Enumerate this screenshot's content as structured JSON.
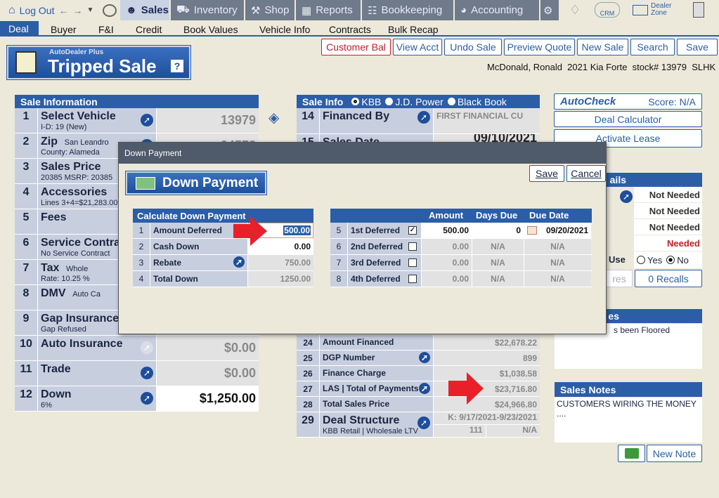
{
  "topnav": {
    "logout": "Log Out",
    "items": [
      "Sales",
      "Inventory",
      "Shop",
      "Reports",
      "Bookkeeping",
      "Accounting"
    ],
    "crm": "CRM",
    "dealer_zone": "Dealer Zone"
  },
  "subnav": [
    "Deal",
    "Buyer",
    "F&I",
    "Credit",
    "Book Values",
    "Vehicle Info",
    "Contracts",
    "Bulk Recap"
  ],
  "toolbar": [
    "Customer Bal",
    "View Acct",
    "Undo Sale",
    "Preview Quote",
    "New Sale",
    "Search",
    "Save"
  ],
  "logo": {
    "small": "AutoDealer Plus",
    "big": "Tripped Sale",
    "help": "?"
  },
  "customer_line": "McDonald, Ronald  2021 Kia Forte  stock# 13979  SLHK",
  "sale_info": {
    "title": "Sale Information",
    "rows": [
      {
        "n": "1",
        "label": "Select Vehicle",
        "sub": "I-D: 19  (New)",
        "value": "13979"
      },
      {
        "n": "2",
        "label": "Zip",
        "extra": "San Leandro",
        "sub": "County: Alameda",
        "value": "94578"
      },
      {
        "n": "3",
        "label": "Sales Price",
        "sub": "20385 MSRP: 20385",
        "value": ""
      },
      {
        "n": "4",
        "label": "Accessories",
        "sub": "Lines 3+4=$21,283.00",
        "value": ""
      },
      {
        "n": "5",
        "label": "Fees",
        "sub": "",
        "value": ""
      },
      {
        "n": "6",
        "label": "Service Contra",
        "sub": "No Service Contract",
        "value": ""
      },
      {
        "n": "7",
        "label": "Tax",
        "extra": "Whole",
        "sub": "Rate: 10.25 %",
        "value": ""
      },
      {
        "n": "8",
        "label": "DMV",
        "extra": "Auto Ca",
        "sub": "",
        "value": ""
      },
      {
        "n": "9",
        "label": "Gap Insurance",
        "sub": "Gap Refused",
        "value": ""
      },
      {
        "n": "10",
        "label": "Auto Insurance",
        "sub": "",
        "value": "$0.00"
      },
      {
        "n": "11",
        "label": "Trade",
        "sub": "",
        "value": "$0.00"
      },
      {
        "n": "12",
        "label": "Down",
        "sub": "6%",
        "value": "$1,250.00"
      }
    ]
  },
  "sale_info2": {
    "title": "Sale Info",
    "radios": [
      "KBB",
      "J.D. Power",
      "Black Book"
    ],
    "rows_top": [
      {
        "n": "14",
        "label": "Financed By",
        "value": "FIRST FINANCIAL CU"
      },
      {
        "n": "15",
        "label": "Sales Date",
        "value": "09/10/2021"
      }
    ],
    "rows_bottom": [
      {
        "n": "24",
        "label": "Amount Financed",
        "value": "$22,678.22"
      },
      {
        "n": "25",
        "label": "DGP Number",
        "value": "899"
      },
      {
        "n": "26",
        "label": "Finance Charge",
        "value": "$1,038.58"
      },
      {
        "n": "27",
        "label": "LAS | Total of Payments",
        "value": "$23,716.80"
      },
      {
        "n": "28",
        "label": "Total Sales Price",
        "value": "$24,966.80"
      }
    ],
    "structure": {
      "n": "29",
      "label": "Deal Structure",
      "sub": "KBB Retail | Wholesale LTV",
      "dates": "K: 9/17/2021-9/23/2021",
      "v1": "111",
      "v2": "N/A"
    }
  },
  "right": {
    "autocheck": "AutoCheck",
    "score": "Score:  N/A",
    "deal_calc": "Deal Calculator",
    "activate_lease": "Activate Lease",
    "details_head": "ails",
    "details": [
      "Not Needed",
      "Not Needed",
      "Not Needed",
      "Needed"
    ],
    "use_label": "Use",
    "yes": "Yes",
    "no": "No",
    "res_label": "res",
    "recalls": "0 Recalls",
    "notes_head": "es",
    "notes_line": "s been Floored",
    "sales_notes_head": "Sales Notes",
    "sales_notes_line": "CUSTOMERS WIRING THE MONEY ....",
    "new_note": "New Note"
  },
  "modal": {
    "window_title": "Down Payment",
    "header": "Down Payment",
    "save": "Save",
    "cancel": "Cancel",
    "calc_title": "Calculate Down Payment",
    "calc_rows": [
      {
        "n": "1",
        "label": "Amount Deferred",
        "value": "500.00"
      },
      {
        "n": "2",
        "label": "Cash Down",
        "value": "0.00"
      },
      {
        "n": "3",
        "label": "Rebate",
        "value": "750.00"
      },
      {
        "n": "4",
        "label": "Total Down",
        "value": "1250.00"
      }
    ],
    "def_headers": [
      "Amount",
      "Days Due",
      "Due Date"
    ],
    "def_rows": [
      {
        "n": "5",
        "label": "1st Deferred",
        "checked": true,
        "amount": "500.00",
        "days": "0",
        "date": "09/20/2021"
      },
      {
        "n": "6",
        "label": "2nd Deferred",
        "checked": false,
        "amount": "0.00",
        "days": "N/A",
        "date": "N/A"
      },
      {
        "n": "7",
        "label": "3rd Deferred",
        "checked": false,
        "amount": "0.00",
        "days": "N/A",
        "date": "N/A"
      },
      {
        "n": "8",
        "label": "4th Deferred",
        "checked": false,
        "amount": "0.00",
        "days": "N/A",
        "date": "N/A"
      }
    ]
  }
}
